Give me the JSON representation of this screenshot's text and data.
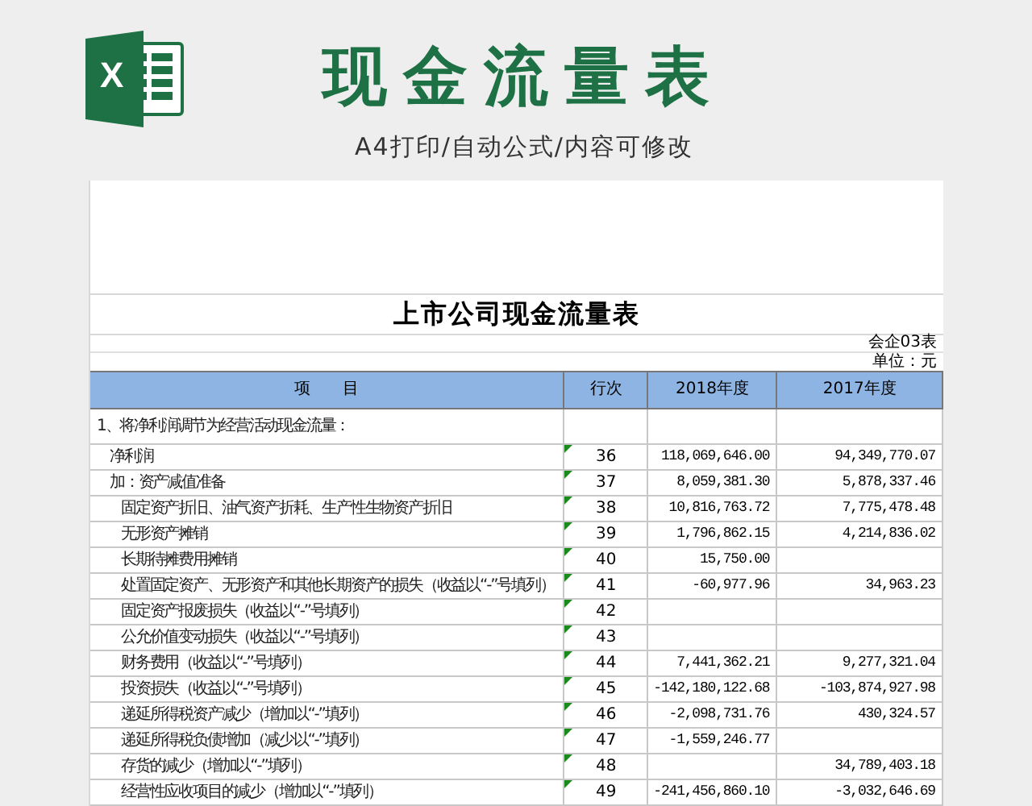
{
  "banner": {
    "logo_letter": "X",
    "title": "现金流量表",
    "subtitle": "A4打印/自动公式/内容可修改"
  },
  "sheet": {
    "title": "上市公司现金流量表",
    "form_code": "会企03表",
    "unit": "单位：元",
    "columns": [
      "项　　目",
      "行次",
      "2018年度",
      "2017年度"
    ],
    "rows": [
      {
        "item": "1、将净利润调节为经营活动现金流量：",
        "children": [
          {
            "item": "净利润",
            "line": "36",
            "y2018": "118,069,646.00",
            "y2017": "94,349,770.07"
          },
          {
            "item": "加：资产减值准备",
            "line": "37",
            "y2018": "8,059,381.30",
            "y2017": "5,878,337.46",
            "children": [
              {
                "item": "固定资产折旧、油气资产折耗、生产性生物资产折旧",
                "line": "38",
                "y2018": "10,816,763.72",
                "y2017": "7,775,478.48"
              },
              {
                "item": "无形资产摊销",
                "line": "39",
                "y2018": "1,796,862.15",
                "y2017": "4,214,836.02"
              },
              {
                "item": "长期待摊费用摊销",
                "line": "40",
                "y2018": "15,750.00"
              },
              {
                "item": "处置固定资产、无形资产和其他长期资产的损失（收益以“-”号填列）",
                "line": "41",
                "y2018": "-60,977.96",
                "y2017": "34,963.23"
              },
              {
                "item": "固定资产报废损失（收益以“-”号填列）",
                "line": "42"
              },
              {
                "item": "公允价值变动损失（收益以“-”号填列）",
                "line": "43"
              },
              {
                "item": "财务费用（收益以“-”号填列）",
                "line": "44",
                "y2018": "7,441,362.21",
                "y2017": "9,277,321.04"
              },
              {
                "item": "投资损失（收益以“-”号填列）",
                "line": "45",
                "y2018": "-142,180,122.68",
                "y2017": "-103,874,927.98"
              },
              {
                "item": "递延所得税资产减少（增加以“-”填列）",
                "line": "46",
                "y2018": "-2,098,731.76",
                "y2017": "430,324.57"
              },
              {
                "item": "递延所得税负债增加（减少以“-”填列）",
                "line": "47",
                "y2018": "-1,559,246.77"
              },
              {
                "item": "存货的减少（增加以“-”填列）",
                "line": "48",
                "y2017": "34,789,403.18"
              },
              {
                "item": "经营性应收项目的减少（增加以“-”填列）",
                "line": "49",
                "y2018": "-241,456,860.10",
                "y2017": "-3,032,646.69"
              }
            ]
          }
        ]
      }
    ]
  }
}
